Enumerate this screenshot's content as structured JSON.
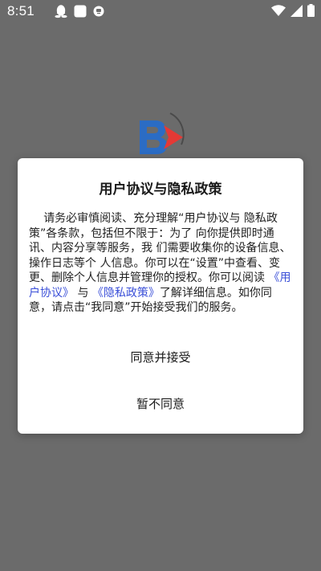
{
  "status_bar": {
    "time": "8:51",
    "left_icons": [
      "qq-icon",
      "square-app-icon",
      "hd-badge-icon"
    ],
    "right_icons": [
      "wifi-icon",
      "cellular-signal-icon",
      "battery-icon"
    ]
  },
  "background": {
    "overlay_color": "#6b6b6b",
    "logo_colors": [
      "#2b6cc4",
      "#e53935"
    ]
  },
  "dialog": {
    "title": "用户协议与隐私政策",
    "body_part1": "请务必审慎阅读、充分理解“用户协议与 隐私政策”各条款，包括但不限于：为了 向你提供即时通讯、内容分享等服务，我 们需要收集你的设备信息、操作日志等个 人信息。你可以在“设置”中查看、变更、删除个人信息并管理你的授权。你可以阅读 ",
    "user_agreement_link": "《用户协议》",
    "body_part2": " 与 ",
    "privacy_policy_link": "《隐私政策》",
    "body_part3": "了解详细信息。如你同意，请点击“我同意”开始接受我们的服务。",
    "accept_label": "同意并接受",
    "decline_label": "暂不同意",
    "link_color": "#3a4fd8"
  }
}
